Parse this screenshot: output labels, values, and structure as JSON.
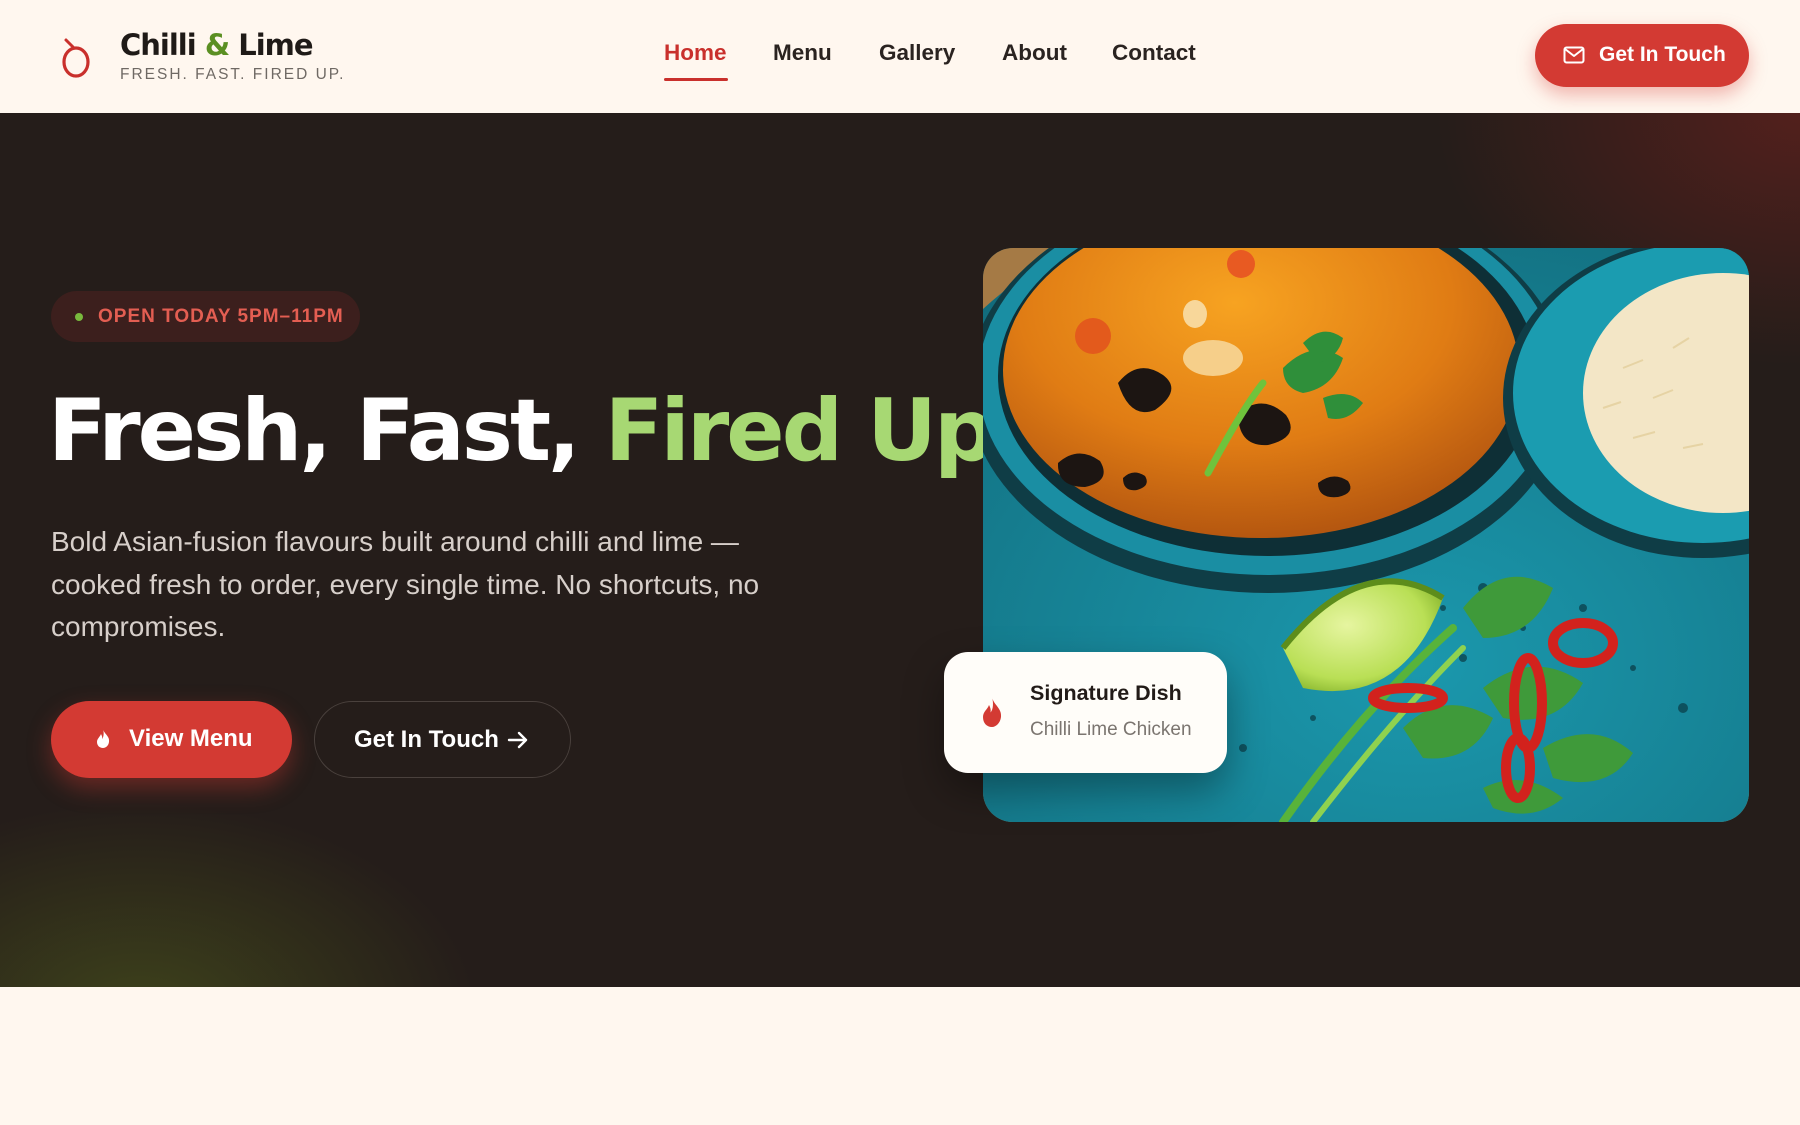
{
  "brand": {
    "name_part1": "Chilli",
    "name_amp": "&",
    "name_part2": "Lime",
    "tagline": "FRESH. FAST. FIRED UP.",
    "logo_icon": "chilli-logo-icon"
  },
  "nav": {
    "items": [
      {
        "label": "Home",
        "active": true
      },
      {
        "label": "Menu",
        "active": false
      },
      {
        "label": "Gallery",
        "active": false
      },
      {
        "label": "About",
        "active": false
      },
      {
        "label": "Contact",
        "active": false
      }
    ],
    "cta_label": "Get In Touch",
    "cta_icon": "mail-icon"
  },
  "hero": {
    "badge": "OPEN TODAY 5PM–11PM",
    "headline_main": "Fresh, Fast,",
    "headline_accent": "Fired Up.",
    "description": "Bold Asian-fusion flavours built around chilli and lime — cooked fresh to order, every single time. No shortcuts, no compromises.",
    "primary_button": "View Menu",
    "primary_icon": "flame-icon",
    "secondary_button": "Get In Touch",
    "secondary_icon": "arrow-right-icon"
  },
  "signature": {
    "title": "Signature Dish",
    "dish": "Chilli Lime Chicken",
    "icon": "flame-icon"
  },
  "colors": {
    "primary_red": "#d33a33",
    "accent_green": "#a7d873",
    "brand_green": "#5b8f22",
    "hero_bg": "#251d1a",
    "page_bg": "#fff7ef"
  }
}
